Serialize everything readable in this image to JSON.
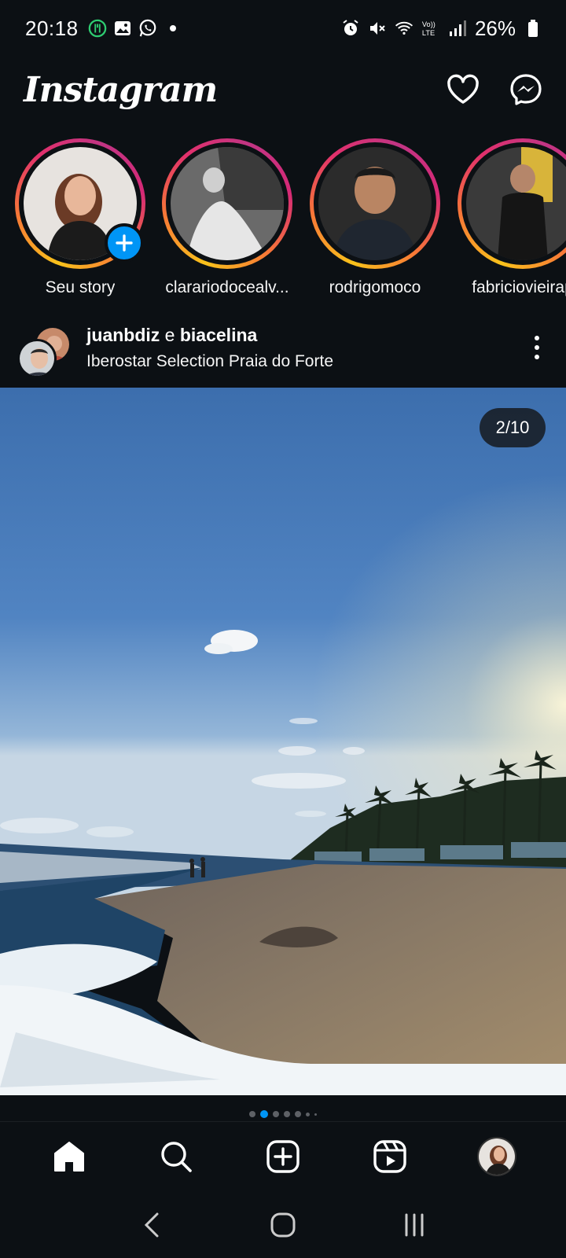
{
  "status_bar": {
    "time": "20:18",
    "battery": "26%",
    "left_icons": [
      "fork-knife-icon",
      "image-icon",
      "whatsapp-icon",
      "dot-icon"
    ],
    "right_icons": [
      "alarm-icon",
      "mute-icon",
      "wifi-icon",
      "volte-icon",
      "signal-icon",
      "battery-icon"
    ]
  },
  "header": {
    "logo": "Instagram",
    "actions": [
      "heart-icon",
      "messenger-icon"
    ]
  },
  "stories": [
    {
      "name": "Seu story",
      "own": true
    },
    {
      "name": "clarariodocealv..."
    },
    {
      "name": "rodrigomoco"
    },
    {
      "name": "fabriciovieirap"
    }
  ],
  "post": {
    "user1": "juanbdiz",
    "connector": " e ",
    "user2": "biacelina",
    "location": "Iberostar Selection Praia do Forte",
    "carousel_counter": "2/10",
    "carousel_index": 2,
    "carousel_total": 10
  },
  "bottom_nav": [
    "home-icon",
    "search-icon",
    "create-icon",
    "reels-icon",
    "profile-avatar"
  ],
  "colors": {
    "background": "#0c1014",
    "accent": "#0095f6"
  }
}
